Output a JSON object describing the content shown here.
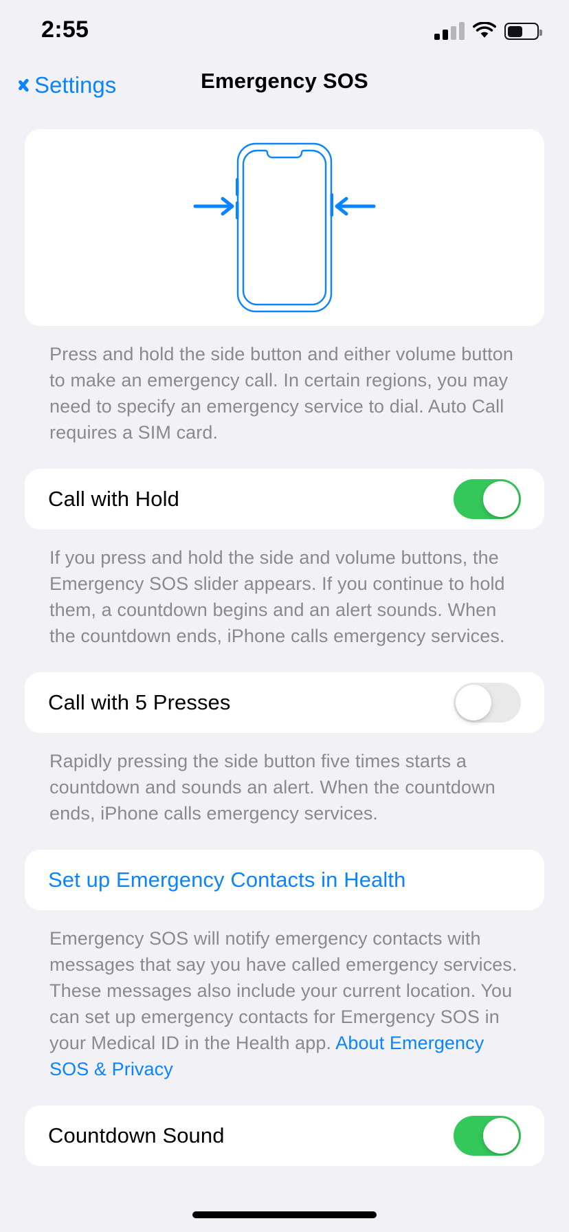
{
  "status_bar": {
    "time": "2:55",
    "signal_icon": "cellular-signal-icon",
    "signal_bars_filled": 2,
    "signal_bars_total": 4,
    "wifi_icon": "wifi-icon",
    "battery_icon": "battery-icon",
    "battery_level_percent": 47
  },
  "nav": {
    "back_icon": "chevron-left-icon",
    "back_label": "Settings",
    "title": "Emergency SOS"
  },
  "illustration": {
    "name": "iphone-side-button-diagram",
    "accent_color": "#0A84FF",
    "arrow_left_icon": "arrow-right-icon",
    "arrow_right_icon": "arrow-left-icon"
  },
  "sections": {
    "intro_footnote": "Press and hold the side button and either volume button to make an emergency call. In certain regions, you may need to specify an emergency service to dial. Auto Call requires a SIM card.",
    "call_with_hold": {
      "label": "Call with Hold",
      "toggle_state": "on",
      "footnote": "If you press and hold the side and volume buttons, the Emergency SOS slider appears. If you continue to hold them, a countdown begins and an alert sounds. When the countdown ends, iPhone calls emergency services."
    },
    "call_with_5_presses": {
      "label": "Call with 5 Presses",
      "toggle_state": "off",
      "footnote": "Rapidly pressing the side button five times starts a countdown and sounds an alert. When the countdown ends, iPhone calls emergency services."
    },
    "emergency_contacts": {
      "link_label": "Set up Emergency Contacts in Health",
      "footnote": "Emergency SOS will notify emergency contacts with messages that say you have called emergency services. These messages also include your current location. You can set up emergency contacts for Emergency SOS in your Medical ID in the Health app.",
      "privacy_link": "About Emergency SOS & Privacy"
    },
    "countdown_sound": {
      "label": "Countdown Sound",
      "toggle_state": "on"
    }
  },
  "colors": {
    "accent_blue": "#0A84FF",
    "toggle_on_green": "#34C759",
    "toggle_off_gray": "#E9E9EA",
    "page_background": "#F2F1F6",
    "card_background": "#FFFFFF",
    "footnote_text": "#8A8A8E"
  }
}
